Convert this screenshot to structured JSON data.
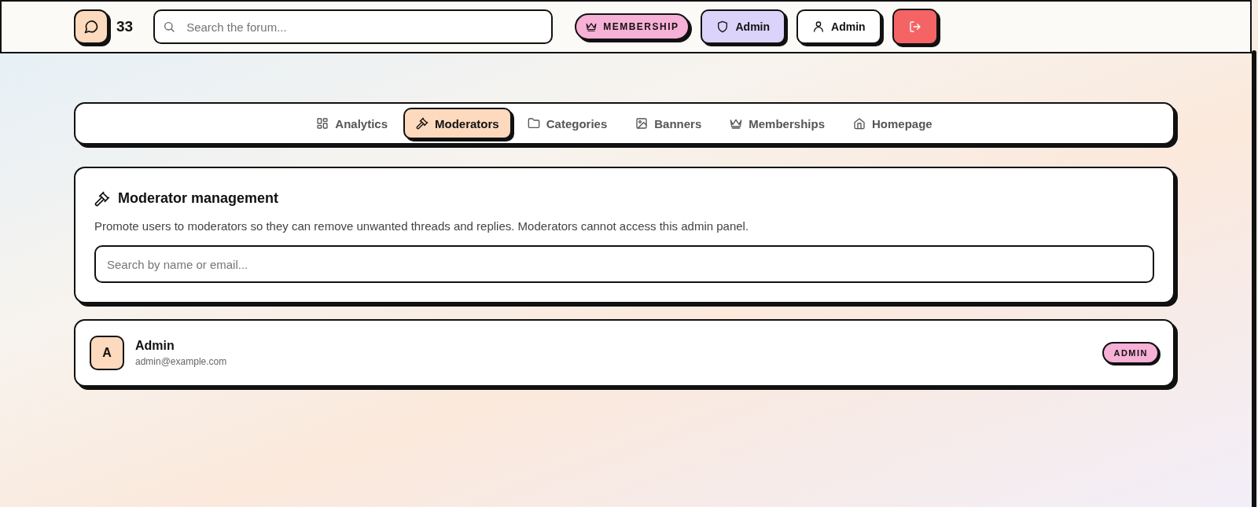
{
  "header": {
    "notification_count": "33",
    "search": {
      "placeholder": "Search the forum..."
    },
    "buttons": [
      {
        "kind": "membership",
        "label": "MEMBERSHIP"
      },
      {
        "kind": "admin",
        "label": "Admin"
      },
      {
        "kind": "profile",
        "label": "Admin"
      },
      {
        "kind": "logout"
      }
    ]
  },
  "tabs": [
    {
      "kind": "analytics",
      "label": "Analytics",
      "selected": false
    },
    {
      "kind": "moderators",
      "label": "Moderators",
      "selected": true
    },
    {
      "kind": "categories",
      "label": "Categories",
      "selected": false
    },
    {
      "kind": "banners",
      "label": "Banners",
      "selected": false
    },
    {
      "kind": "memberships",
      "label": "Memberships",
      "selected": false
    },
    {
      "kind": "homepage",
      "label": "Homepage",
      "selected": false
    }
  ],
  "moderator_management": {
    "title": "Moderator management",
    "description": "Promote users to moderators so they can remove unwanted threads and replies. Moderators cannot access this admin panel.",
    "search": {
      "placeholder": "Search by name or email..."
    }
  },
  "users": [
    {
      "initial": "A",
      "name": "Admin",
      "email": "admin@example.com",
      "role": "ADMIN"
    }
  ]
}
